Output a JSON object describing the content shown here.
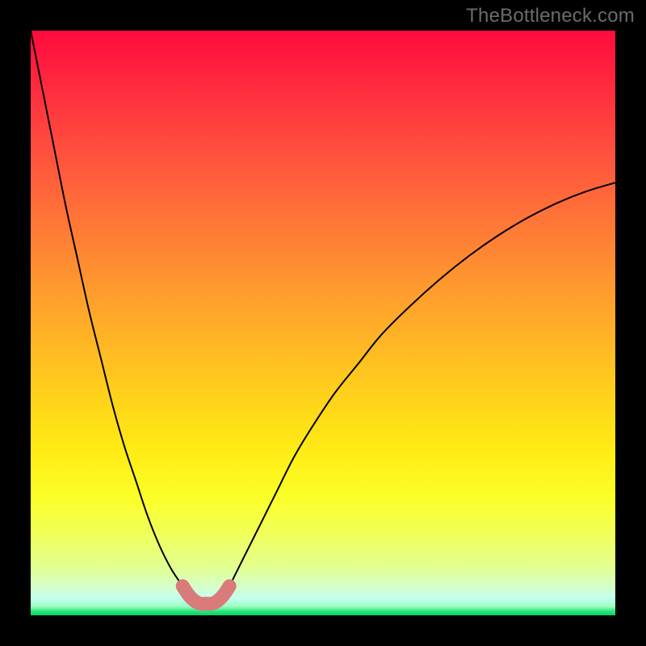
{
  "watermark": "TheBottleneck.com",
  "colors": {
    "frame": "#000000",
    "curve": "#000000",
    "curve_marker": "#d97a7b",
    "gradient_top": "#ff0b3e",
    "gradient_bottom": "#05d36a"
  },
  "chart_data": {
    "type": "line",
    "title": "",
    "xlabel": "",
    "ylabel": "",
    "xlim": [
      0,
      100
    ],
    "ylim": [
      0,
      100
    ],
    "x": [
      0,
      2,
      4,
      6,
      8,
      10,
      12,
      14,
      16,
      18,
      20,
      22,
      24,
      26,
      27,
      28,
      29,
      30,
      31,
      32,
      33,
      34,
      35,
      36,
      38,
      40,
      42,
      45,
      48,
      52,
      56,
      60,
      65,
      70,
      75,
      80,
      85,
      90,
      95,
      100
    ],
    "values": [
      100,
      90,
      80,
      70,
      61,
      52,
      44,
      36,
      29,
      23,
      17,
      12,
      8,
      5,
      3.5,
      2.5,
      2,
      2,
      2,
      2.5,
      3.5,
      5,
      7,
      9,
      13,
      17,
      21,
      27,
      32,
      38,
      43,
      48,
      53,
      57.5,
      61.5,
      65,
      68,
      70.5,
      72.5,
      74
    ],
    "marker_band": {
      "x": [
        26,
        27,
        28,
        29,
        30,
        31,
        32,
        33,
        34
      ],
      "values": [
        5,
        3.5,
        2.5,
        2,
        2,
        2,
        2.5,
        3.5,
        5
      ]
    },
    "annotations": []
  }
}
